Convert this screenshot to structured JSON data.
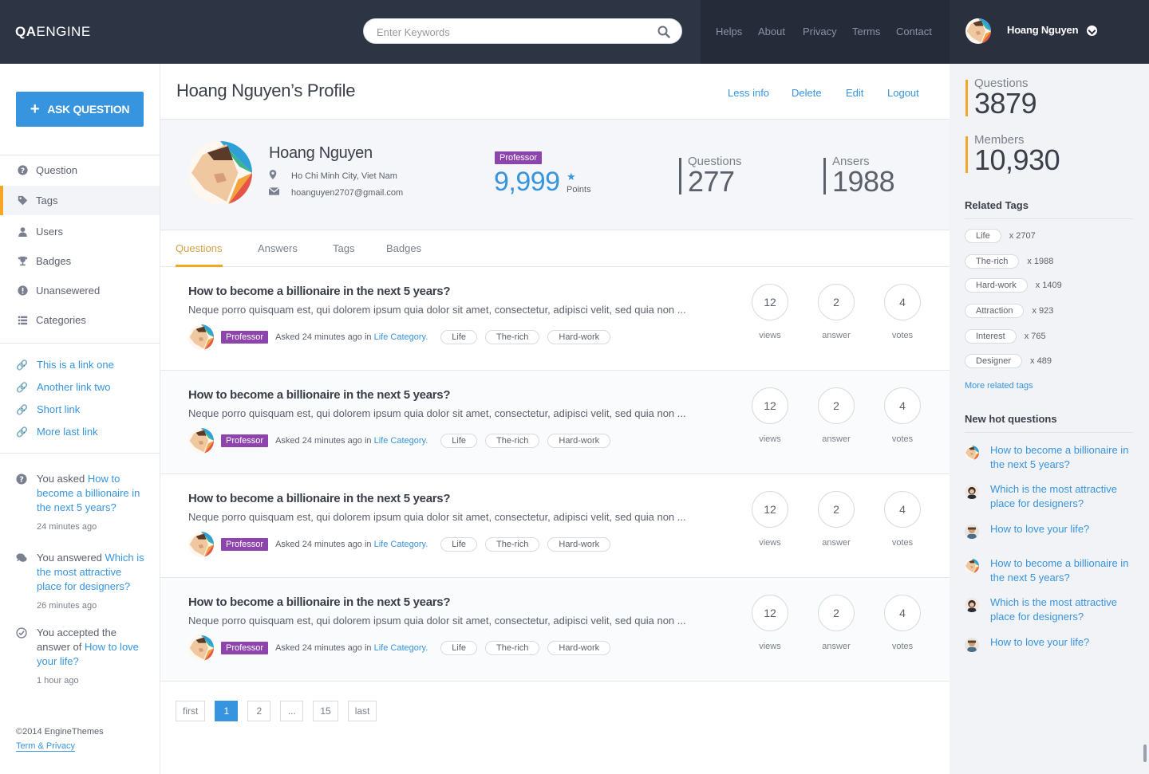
{
  "brand": {
    "logo_bold": "QA",
    "logo_rest": "ENGINE"
  },
  "search": {
    "placeholder": "Enter Keywords"
  },
  "topnav": [
    "Helps",
    "About",
    "Privacy",
    "Terms",
    "Contact"
  ],
  "user": {
    "name": "Hoang Nguyen"
  },
  "sidebar": {
    "ask_label": "ASK QUESTION",
    "menu": [
      {
        "label": "Question",
        "icon": "question-circle-icon"
      },
      {
        "label": "Tags",
        "icon": "tag-icon",
        "active": true
      },
      {
        "label": "Users",
        "icon": "user-icon"
      },
      {
        "label": "Badges",
        "icon": "trophy-icon"
      },
      {
        "label": "Unansewered",
        "icon": "exclamation-circle-icon"
      },
      {
        "label": "Categories",
        "icon": "list-icon"
      }
    ],
    "links": [
      "This is a link one",
      "Another link two",
      "Short link",
      "More last link"
    ],
    "activity": [
      {
        "prefix": "You asked ",
        "link": "How to become a billionaire in the next 5 years?",
        "time": "24 minutes ago",
        "icon": "question-circle-icon"
      },
      {
        "prefix": "You answered ",
        "link": "Which is the most attractive place for designers?",
        "time": "26 minutes ago",
        "icon": "comments-icon"
      },
      {
        "prefix": "You accepted the answer of ",
        "link": "How to love your life?",
        "time": "1 hour ago",
        "icon": "check-circle-icon"
      }
    ],
    "copyright": "©2014 EngineThemes",
    "terms": "Term & Privacy"
  },
  "profile": {
    "page_title": "Hoang Nguyen’s Profile",
    "actions": [
      "Less info",
      "Delete",
      "Edit",
      "Logout"
    ],
    "name": "Hoang Nguyen",
    "location": "Ho Chi Minh City, Viet Nam",
    "email": "hoanguyen2707@gmail.com",
    "badge": "Professor",
    "points": "9,999",
    "points_label": "Points",
    "questions_label": "Questions",
    "questions_value": "277",
    "answers_label": "Ansers",
    "answers_value": "1988"
  },
  "tabs": [
    "Questions",
    "Answers",
    "Tags",
    "Badges"
  ],
  "questions": [
    {
      "title": "How to become a billionaire in the next 5 years?",
      "excerpt": "Neque porro quisquam est, qui dolorem ipsum quia dolor sit amet, consectetur, adipisci velit, sed quia non ...",
      "badge": "Professor",
      "asked": "Asked 24 minutes ago in ",
      "category": "Life Category.",
      "tags": [
        "Life",
        "The-rich",
        "Hard-work"
      ],
      "views": "12",
      "answers": "2",
      "votes": "4"
    },
    {
      "title": "How to become a billionaire in the next 5 years?",
      "excerpt": "Neque porro quisquam est, qui dolorem ipsum quia dolor sit amet, consectetur, adipisci velit, sed quia non ...",
      "badge": "Professor",
      "asked": "Asked 24 minutes ago in ",
      "category": "Life Category.",
      "tags": [
        "Life",
        "The-rich",
        "Hard-work"
      ],
      "views": "12",
      "answers": "2",
      "votes": "4"
    },
    {
      "title": "How to become a billionaire in the next 5 years?",
      "excerpt": "Neque porro quisquam est, qui dolorem ipsum quia dolor sit amet, consectetur, adipisci velit, sed quia non ...",
      "badge": "Professor",
      "asked": "Asked 24 minutes ago in ",
      "category": "Life Category.",
      "tags": [
        "Life",
        "The-rich",
        "Hard-work"
      ],
      "views": "12",
      "answers": "2",
      "votes": "4"
    },
    {
      "title": "How to become a billionaire in the next 5 years?",
      "excerpt": "Neque porro quisquam est, qui dolorem ipsum quia dolor sit amet, consectetur, adipisci velit, sed quia non ...",
      "badge": "Professor",
      "asked": "Asked 24 minutes ago in ",
      "category": "Life Category.",
      "tags": [
        "Life",
        "The-rich",
        "Hard-work"
      ],
      "views": "12",
      "answers": "2",
      "votes": "4"
    }
  ],
  "stat_labels": {
    "views": "views",
    "answers": "answer",
    "votes": "votes"
  },
  "pagination": [
    "first",
    "1",
    "2",
    "...",
    "15",
    "last"
  ],
  "right": {
    "questions_label": "Questions",
    "questions_value": "3879",
    "members_label": "Members",
    "members_value": "10,930",
    "related_heading": "Related Tags",
    "related_tags": [
      {
        "name": "Life",
        "count": "x 2707"
      },
      {
        "name": "The-rich",
        "count": "x 1988"
      },
      {
        "name": "Hard-work",
        "count": "x 1409"
      },
      {
        "name": "Attraction",
        "count": "x 923"
      },
      {
        "name": "Interest",
        "count": "x 765"
      },
      {
        "name": "Designer",
        "count": "x 489"
      }
    ],
    "more_tags": "More related tags",
    "hot_heading": "New hot questions",
    "hot_questions": [
      {
        "text": "How to become a billionaire in the next 5 years?",
        "avatar": "a"
      },
      {
        "text": "Which is the most attractive place for designers?",
        "avatar": "b"
      },
      {
        "text": "How to love your life?",
        "avatar": "c"
      },
      {
        "text": "How to become a billionaire in the next 5 years?",
        "avatar": "a"
      },
      {
        "text": "Which is the most attractive place for designers?",
        "avatar": "b"
      },
      {
        "text": "How to love your life?",
        "avatar": "c"
      }
    ]
  },
  "colors": {
    "accent": "#3794de",
    "highlight": "#f5a623",
    "badge": "#8e44ad",
    "topbar": "#2d3443"
  }
}
